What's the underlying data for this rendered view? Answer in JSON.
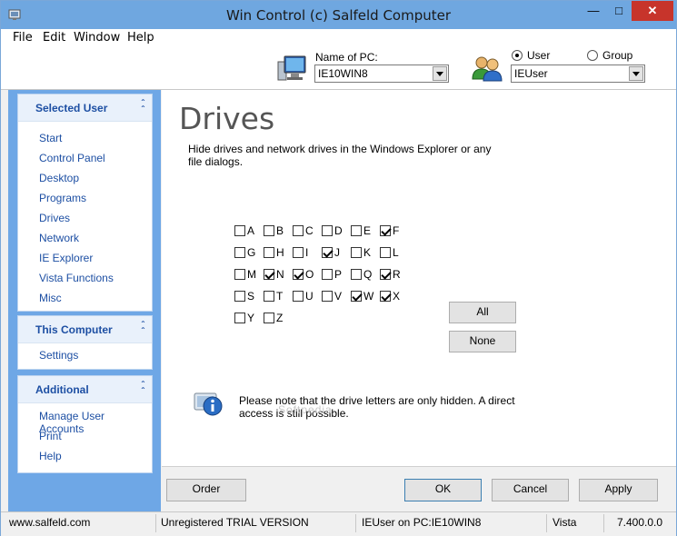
{
  "window": {
    "title": "Win Control (c) Salfeld Computer"
  },
  "menu": [
    "File",
    "Edit",
    "Window",
    "Help"
  ],
  "header": {
    "pc_label": "Name of PC:",
    "pc_value": "IE10WIN8",
    "user_radio": "User",
    "group_radio": "Group",
    "user_value": "IEUser"
  },
  "sidebar": {
    "selected_user": {
      "title": "Selected User",
      "items": [
        "Start",
        "Control Panel",
        "Desktop",
        "Programs",
        "Drives",
        "Network",
        "IE Explorer",
        "Vista Functions",
        "Misc"
      ]
    },
    "this_computer": {
      "title": "This Computer",
      "items": [
        "Settings"
      ]
    },
    "additional": {
      "title": "Additional",
      "items": [
        "Manage User Accounts",
        "Print",
        "Help"
      ]
    }
  },
  "main": {
    "title": "Drives",
    "description": "Hide drives and network drives in the Windows Explorer or any file dialogs.",
    "drives": [
      {
        "letter": "A",
        "checked": false
      },
      {
        "letter": "B",
        "checked": false
      },
      {
        "letter": "C",
        "checked": false
      },
      {
        "letter": "D",
        "checked": false
      },
      {
        "letter": "E",
        "checked": false
      },
      {
        "letter": "F",
        "checked": true
      },
      {
        "letter": "G",
        "checked": false
      },
      {
        "letter": "H",
        "checked": false
      },
      {
        "letter": "I",
        "checked": false
      },
      {
        "letter": "J",
        "checked": true
      },
      {
        "letter": "K",
        "checked": false
      },
      {
        "letter": "L",
        "checked": false
      },
      {
        "letter": "M",
        "checked": false
      },
      {
        "letter": "N",
        "checked": true
      },
      {
        "letter": "O",
        "checked": true
      },
      {
        "letter": "P",
        "checked": false
      },
      {
        "letter": "Q",
        "checked": false
      },
      {
        "letter": "R",
        "checked": true
      },
      {
        "letter": "S",
        "checked": false
      },
      {
        "letter": "T",
        "checked": false
      },
      {
        "letter": "U",
        "checked": false
      },
      {
        "letter": "V",
        "checked": false
      },
      {
        "letter": "W",
        "checked": true
      },
      {
        "letter": "X",
        "checked": true
      },
      {
        "letter": "Y",
        "checked": false
      },
      {
        "letter": "Z",
        "checked": false
      }
    ],
    "all_button": "All",
    "none_button": "None",
    "note": "Please note that the drive letters are only hidden. A direct access is still possible.",
    "watermark": "Softpedia"
  },
  "buttons": {
    "order": "Order",
    "ok": "OK",
    "cancel": "Cancel",
    "apply": "Apply"
  },
  "status": {
    "website": "www.salfeld.com",
    "license": "Unregistered TRIAL VERSION",
    "session": "IEUser on PC:IE10WIN8",
    "os": "Vista",
    "version": "7.400.0.0"
  },
  "colors": {
    "sidebar": "#6ea7e6",
    "titlebar": "#6fa7e0",
    "link": "#1d4fa3",
    "close": "#c7342b"
  }
}
